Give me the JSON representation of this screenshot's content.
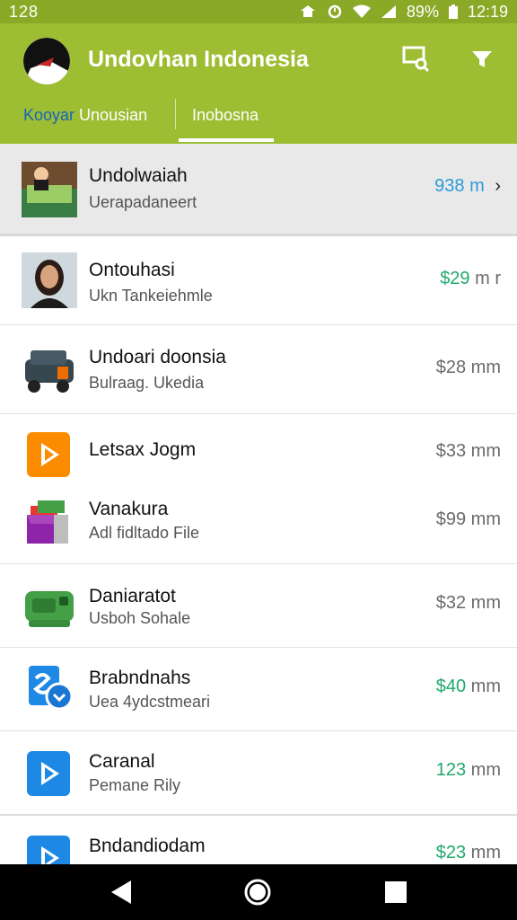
{
  "status_bar": {
    "left_text": "128",
    "battery_text": "89%",
    "time": "12:19"
  },
  "app_bar": {
    "title": "Undovhan Indonesia",
    "tabs": [
      {
        "label_accent": "Kooyar",
        "label_rest": " Unousian",
        "selected": false
      },
      {
        "label": "Inobosna",
        "selected": true
      }
    ],
    "actions": [
      "search-card-icon",
      "filter-icon"
    ]
  },
  "list": {
    "items": [
      {
        "title": "Undolwaiah",
        "subtitle": "Uerapadaneert",
        "price_value": "938",
        "price_unit": " m",
        "price_color": "blue",
        "chevron": "›",
        "thumb": "photo-table"
      },
      {
        "title": "Ontouhasi",
        "subtitle": "Ukn Tankeiehmle",
        "price_value": "$29",
        "price_unit": " m r",
        "price_color": "green",
        "thumb": "photo-woman"
      },
      {
        "title": "Undoari doonsia",
        "subtitle": "Bulraag. Ukedia",
        "price_value": "$28",
        "price_unit": " mm",
        "price_color": "gray",
        "thumb": "device-icon"
      },
      {
        "title": "Letsax Jogm",
        "subtitle": "",
        "price_value": "$33",
        "price_unit": " mm",
        "price_color": "gray",
        "thumb": "play-orange-icon"
      },
      {
        "title": "Vanakura",
        "subtitle": "Adl fidltado File",
        "price_value": "$99",
        "price_unit": " mm",
        "price_color": "gray",
        "thumb": "box-purple-icon"
      },
      {
        "title": "Daniaratot",
        "subtitle": "Usboh Sohale",
        "price_value": "$32",
        "price_unit": " mm",
        "price_color": "gray",
        "thumb": "green-device-icon"
      },
      {
        "title": "Brabndnahs",
        "subtitle": "Uea 4ydcstmeari",
        "price_value": "$40",
        "price_unit": " mm",
        "price_color": "green",
        "thumb": "blue-doc-icon"
      },
      {
        "title": "Caranal",
        "subtitle": "Pemane Rily",
        "price_value": "123",
        "price_unit": " mm",
        "price_color": "green",
        "thumb": "play-blue-icon"
      },
      {
        "title": "Bndandiodam",
        "subtitle": "",
        "price_value": "$23",
        "price_unit": " mm",
        "price_color": "green",
        "thumb": "play-blue-icon"
      }
    ]
  },
  "colors": {
    "app_bar": "#9dbd32",
    "status_bar": "#8aa927",
    "price_green": "#1fa86c",
    "price_blue": "#2b9bd8"
  }
}
